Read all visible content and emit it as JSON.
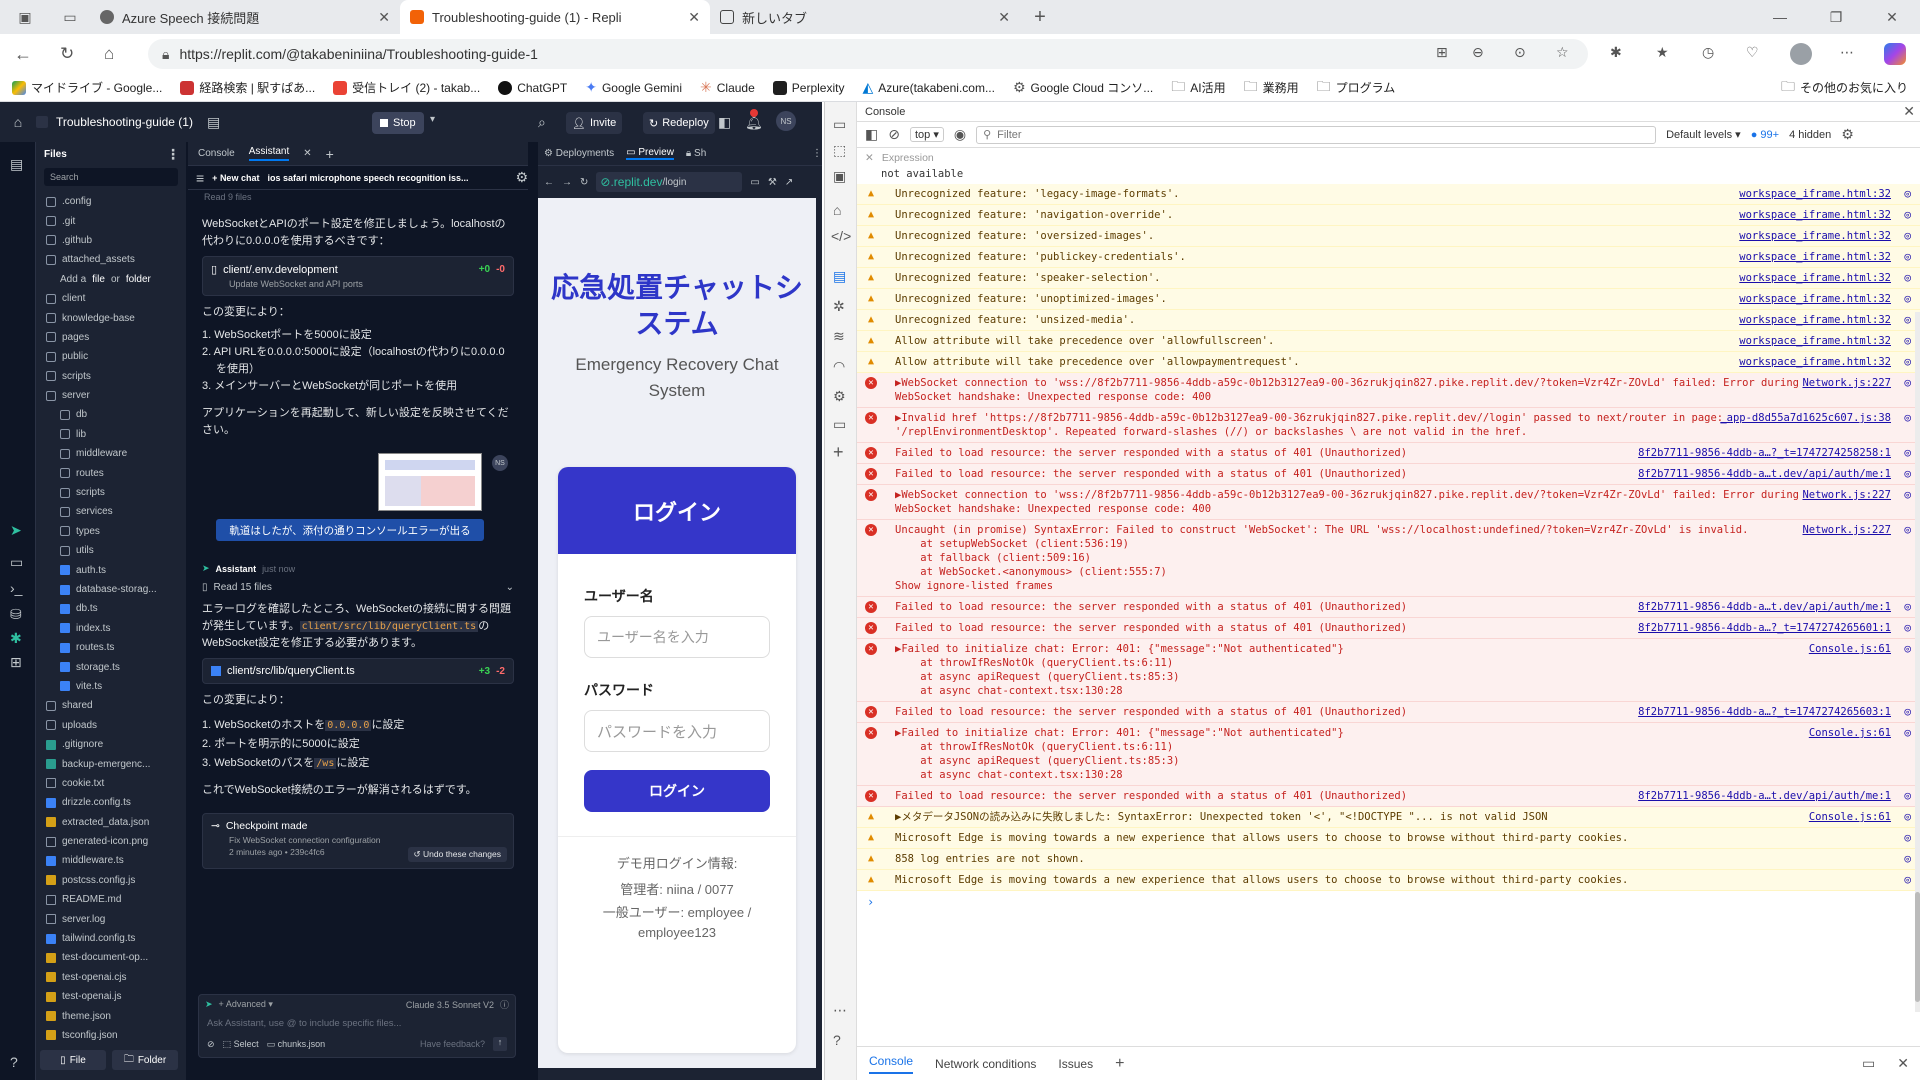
{
  "browser": {
    "tabs": [
      {
        "title": "Azure Speech 接続問題",
        "favicon": "#6b6b6b"
      },
      {
        "title": "Troubleshooting-guide (1) - Repli",
        "favicon": "#f26207"
      },
      {
        "title": "新しいタブ",
        "favicon": "#444"
      }
    ],
    "url": "https://replit.com/@takabeniniina/Troubleshooting-guide-1",
    "bookmarks": [
      "マイドライブ - Google...",
      "経路検索 | 駅すぱあ...",
      "受信トレイ (2) - takab...",
      "ChatGPT",
      "Google Gemini",
      "Claude",
      "Perplexity",
      "Azure(takabeni.com...",
      "Google Cloud コンソ...",
      "AI活用",
      "業務用",
      "プログラム"
    ],
    "other_bookmarks": "その他のお気に入り"
  },
  "replit": {
    "project": "Troubleshooting-guide (1)",
    "stop": "Stop",
    "invite": "Invite",
    "redeploy": "Redeploy",
    "avatar": "NS",
    "files_title": "Files",
    "search": "Search",
    "add_a": "Add a",
    "file": "file",
    "or": "or",
    "folder": "folder",
    "tree": [
      {
        "n": ".config",
        "t": "d",
        "i": 0
      },
      {
        "n": ".git",
        "t": "d",
        "i": 0
      },
      {
        "n": ".github",
        "t": "d",
        "i": 0
      },
      {
        "n": "attached_assets",
        "t": "d",
        "i": 0
      },
      {
        "n": "client",
        "t": "d",
        "i": 0
      },
      {
        "n": "knowledge-base",
        "t": "d",
        "i": 0
      },
      {
        "n": "pages",
        "t": "d",
        "i": 0
      },
      {
        "n": "public",
        "t": "d",
        "i": 0
      },
      {
        "n": "scripts",
        "t": "d",
        "i": 0
      },
      {
        "n": "server",
        "t": "d",
        "i": 0
      },
      {
        "n": "db",
        "t": "d",
        "i": 1
      },
      {
        "n": "lib",
        "t": "d",
        "i": 1
      },
      {
        "n": "middleware",
        "t": "d",
        "i": 1
      },
      {
        "n": "routes",
        "t": "d",
        "i": 1
      },
      {
        "n": "scripts",
        "t": "d",
        "i": 1
      },
      {
        "n": "services",
        "t": "d",
        "i": 1
      },
      {
        "n": "types",
        "t": "d",
        "i": 1
      },
      {
        "n": "utils",
        "t": "d",
        "i": 1
      },
      {
        "n": "auth.ts",
        "t": "f",
        "i": 1
      },
      {
        "n": "database-storag...",
        "t": "f",
        "i": 1
      },
      {
        "n": "db.ts",
        "t": "f",
        "i": 1
      },
      {
        "n": "index.ts",
        "t": "f",
        "i": 1
      },
      {
        "n": "routes.ts",
        "t": "f",
        "i": 1
      },
      {
        "n": "storage.ts",
        "t": "f",
        "i": 1
      },
      {
        "n": "vite.ts",
        "t": "f",
        "i": 1
      },
      {
        "n": "shared",
        "t": "d",
        "i": 0
      },
      {
        "n": "uploads",
        "t": "d",
        "i": 0
      },
      {
        "n": ".gitignore",
        "t": "g",
        "i": 0
      },
      {
        "n": "backup-emergenc...",
        "t": "g",
        "i": 0
      },
      {
        "n": "cookie.txt",
        "t": "o",
        "i": 0
      },
      {
        "n": "drizzle.config.ts",
        "t": "f",
        "i": 0
      },
      {
        "n": "extracted_data.json",
        "t": "y",
        "i": 0
      },
      {
        "n": "generated-icon.png",
        "t": "o",
        "i": 0
      },
      {
        "n": "middleware.ts",
        "t": "f",
        "i": 0
      },
      {
        "n": "postcss.config.js",
        "t": "y",
        "i": 0
      },
      {
        "n": "README.md",
        "t": "o",
        "i": 0
      },
      {
        "n": "server.log",
        "t": "o",
        "i": 0
      },
      {
        "n": "tailwind.config.ts",
        "t": "f",
        "i": 0
      },
      {
        "n": "test-document-op...",
        "t": "y",
        "i": 0
      },
      {
        "n": "test-openai.cjs",
        "t": "y",
        "i": 0
      },
      {
        "n": "test-openai.js",
        "t": "y",
        "i": 0
      },
      {
        "n": "theme.json",
        "t": "y",
        "i": 0
      },
      {
        "n": "tsconfig.json",
        "t": "y",
        "i": 0
      }
    ],
    "file_btn": "File",
    "folder_btn": "Folder",
    "pane_tabs": [
      "Console",
      "Assistant"
    ],
    "new_chat": "New chat",
    "chat_title": "ios safari microphone speech recognition iss...",
    "read_9": "Read 9 files",
    "msg1": "WebSocketとAPIのポート設定を修正しましょう。localhostの代わりに0.0.0.0を使用するべきです：",
    "card1": {
      "path": "client/.env.development",
      "desc": "Update WebSocket and API ports",
      "add": "+0",
      "del": "-0"
    },
    "changes_head": "この変更により：",
    "list1": [
      "1. WebSocketポートを5000に設定",
      "2. API URLを0.0.0.0:5000に設定（localhostの代わりに0.0.0.0を使用）",
      "3. メインサーバーとWebSocketが同じポートを使用"
    ],
    "msg2": "アプリケーションを再起動して、新しい設定を反映させてください。",
    "user_msg": "軌道はしたが、添付の通りコンソールエラーが出る",
    "user_avatar": "NS",
    "assistant": "Assistant",
    "just_now": "just now",
    "read_15": "Read 15 files",
    "msg3a": "エラーログを確認したところ、WebSocketの接続に関する問題が発生しています。",
    "msg3code": "client/src/lib/queryClient.ts",
    "msg3b": "のWebSocket設定を修正する必要があります。",
    "card2": {
      "path": "client/src/lib/queryClient.ts",
      "add": "+3",
      "del": "-2"
    },
    "changes_head2": "この変更により：",
    "l2a": "1. WebSocketのホストを",
    "l2a_code": "0.0.0.0",
    "l2a_end": "に設定",
    "l2b": "2. ポートを明示的に5000に設定",
    "l2c": "3. WebSocketのパスを",
    "l2c_code": "/ws",
    "l2c_end": "に設定",
    "msg4": "これでWebSocket接続のエラーが解消されるはずです。",
    "checkpoint": {
      "title": "Checkpoint made",
      "desc": "Fix WebSocket connection configuration",
      "meta": "2 minutes ago • 239c4fc6",
      "undo": "Undo these changes"
    },
    "advanced": "Advanced",
    "model": "Claude 3.5 Sonnet V2",
    "input_placeholder": "Ask Assistant, use @ to include specific files...",
    "select": "Select",
    "chunks": "chunks.json",
    "feedback": "Have feedback?",
    "preview_tabs": [
      "Deployments",
      "Preview",
      "Sh"
    ],
    "preview_url_host": ".replit.dev",
    "preview_url_path": "/login",
    "app": {
      "title": "応急処置チャットシステム",
      "subtitle": "Emergency Recovery Chat System",
      "login_header": "ログイン",
      "user_label": "ユーザー名",
      "user_ph": "ユーザー名を入力",
      "pass_label": "パスワード",
      "pass_ph": "パスワードを入力",
      "login_btn": "ログイン",
      "demo": "デモ用ログイン情報:",
      "admin": "管理者: niina / 0077",
      "general": "一般ユーザー: employee / employee123"
    }
  },
  "devtools": {
    "title": "Console",
    "context": "top",
    "filter": "Filter",
    "levels": "Default levels",
    "badge": "99+",
    "hidden": "4 hidden",
    "expression": "Expression",
    "not_available": "not available",
    "bottom_tabs": [
      "Console",
      "Network conditions",
      "Issues"
    ],
    "logs": [
      {
        "k": "warn",
        "m": "Unrecognized feature: 'legacy-image-formats'.",
        "s": "workspace_iframe.html:32"
      },
      {
        "k": "warn",
        "m": "Unrecognized feature: 'navigation-override'.",
        "s": "workspace_iframe.html:32"
      },
      {
        "k": "warn",
        "m": "Unrecognized feature: 'oversized-images'.",
        "s": "workspace_iframe.html:32"
      },
      {
        "k": "warn",
        "m": "Unrecognized feature: 'publickey-credentials'.",
        "s": "workspace_iframe.html:32"
      },
      {
        "k": "warn",
        "m": "Unrecognized feature: 'speaker-selection'.",
        "s": "workspace_iframe.html:32"
      },
      {
        "k": "warn",
        "m": "Unrecognized feature: 'unoptimized-images'.",
        "s": "workspace_iframe.html:32"
      },
      {
        "k": "warn",
        "m": "Unrecognized feature: 'unsized-media'.",
        "s": "workspace_iframe.html:32"
      },
      {
        "k": "warn",
        "m": "Allow attribute will take precedence over 'allowfullscreen'.",
        "s": "workspace_iframe.html:32"
      },
      {
        "k": "warn",
        "m": "Allow attribute will take precedence over 'allowpaymentrequest'.",
        "s": "workspace_iframe.html:32"
      },
      {
        "k": "err",
        "m": "▶WebSocket connection to 'wss://8f2b7711-9856-4ddb-a59c-0b12b3127ea9-00-36zrukjqin827.pike.replit.dev/?token=Vzr4Zr-ZOvLd' failed: Error during WebSocket handshake: Unexpected response code: 400",
        "s": "Network.js:227"
      },
      {
        "k": "err",
        "m": "▶Invalid href 'https://8f2b7711-9856-4ddb-a59c-0b12b3127ea9-00-36zrukjqin827.pike.replit.dev//login' passed to next/router in page: '/replEnvironmentDesktop'. Repeated forward-slashes (//) or backslashes \\ are not valid in the href.",
        "s": "_app-d8d55a7d1625c607.js:38"
      },
      {
        "k": "err",
        "m": "Failed to load resource: the server responded with a status of 401 (Unauthorized)",
        "s": "8f2b7711-9856-4ddb-a…?_t=1747274258258:1"
      },
      {
        "k": "err",
        "m": "Failed to load resource: the server responded with a status of 401 (Unauthorized)",
        "s": "8f2b7711-9856-4ddb-a…t.dev/api/auth/me:1"
      },
      {
        "k": "err",
        "m": "▶WebSocket connection to 'wss://8f2b7711-9856-4ddb-a59c-0b12b3127ea9-00-36zrukjqin827.pike.replit.dev/?token=Vzr4Zr-ZOvLd' failed: Error during WebSocket handshake: Unexpected response code: 400",
        "s": "Network.js:227"
      },
      {
        "k": "err",
        "m": "Uncaught (in promise) SyntaxError: Failed to construct 'WebSocket': The URL 'wss://localhost:undefined/?token=Vzr4Zr-ZOvLd' is invalid.\n    at setupWebSocket (client:536:19)\n    at fallback (client:509:16)\n    at WebSocket.<anonymous> (client:555:7)\nShow ignore-listed frames",
        "s": "Network.js:227"
      },
      {
        "k": "err",
        "m": "Failed to load resource: the server responded with a status of 401 (Unauthorized)",
        "s": "8f2b7711-9856-4ddb-a…t.dev/api/auth/me:1"
      },
      {
        "k": "err",
        "m": "Failed to load resource: the server responded with a status of 401 (Unauthorized)",
        "s": "8f2b7711-9856-4ddb-a…?_t=1747274265601:1"
      },
      {
        "k": "err",
        "m": "▶Failed to initialize chat: Error: 401: {\"message\":\"Not authenticated\"}\n    at throwIfResNotOk (queryClient.ts:6:11)\n    at async apiRequest (queryClient.ts:85:3)\n    at async chat-context.tsx:130:28",
        "s": "Console.js:61"
      },
      {
        "k": "err",
        "m": "Failed to load resource: the server responded with a status of 401 (Unauthorized)",
        "s": "8f2b7711-9856-4ddb-a…?_t=1747274265603:1"
      },
      {
        "k": "err",
        "m": "▶Failed to initialize chat: Error: 401: {\"message\":\"Not authenticated\"}\n    at throwIfResNotOk (queryClient.ts:6:11)\n    at async apiRequest (queryClient.ts:85:3)\n    at async chat-context.tsx:130:28",
        "s": "Console.js:61"
      },
      {
        "k": "err",
        "m": "Failed to load resource: the server responded with a status of 401 (Unauthorized)",
        "s": "8f2b7711-9856-4ddb-a…t.dev/api/auth/me:1"
      },
      {
        "k": "warn",
        "m": "▶メタデータJSONの読み込みに失敗しました: SyntaxError: Unexpected token '<', \"<!DOCTYPE \"... is not valid JSON",
        "s": "Console.js:61"
      },
      {
        "k": "warn",
        "m": "Microsoft Edge is moving towards a new experience that allows users to choose to browse without third-party cookies.",
        "s": ""
      },
      {
        "k": "warn",
        "m": "858 log entries are not shown.",
        "s": ""
      },
      {
        "k": "warn",
        "m": "Microsoft Edge is moving towards a new experience that allows users to choose to browse without third-party cookies.",
        "s": ""
      }
    ]
  }
}
